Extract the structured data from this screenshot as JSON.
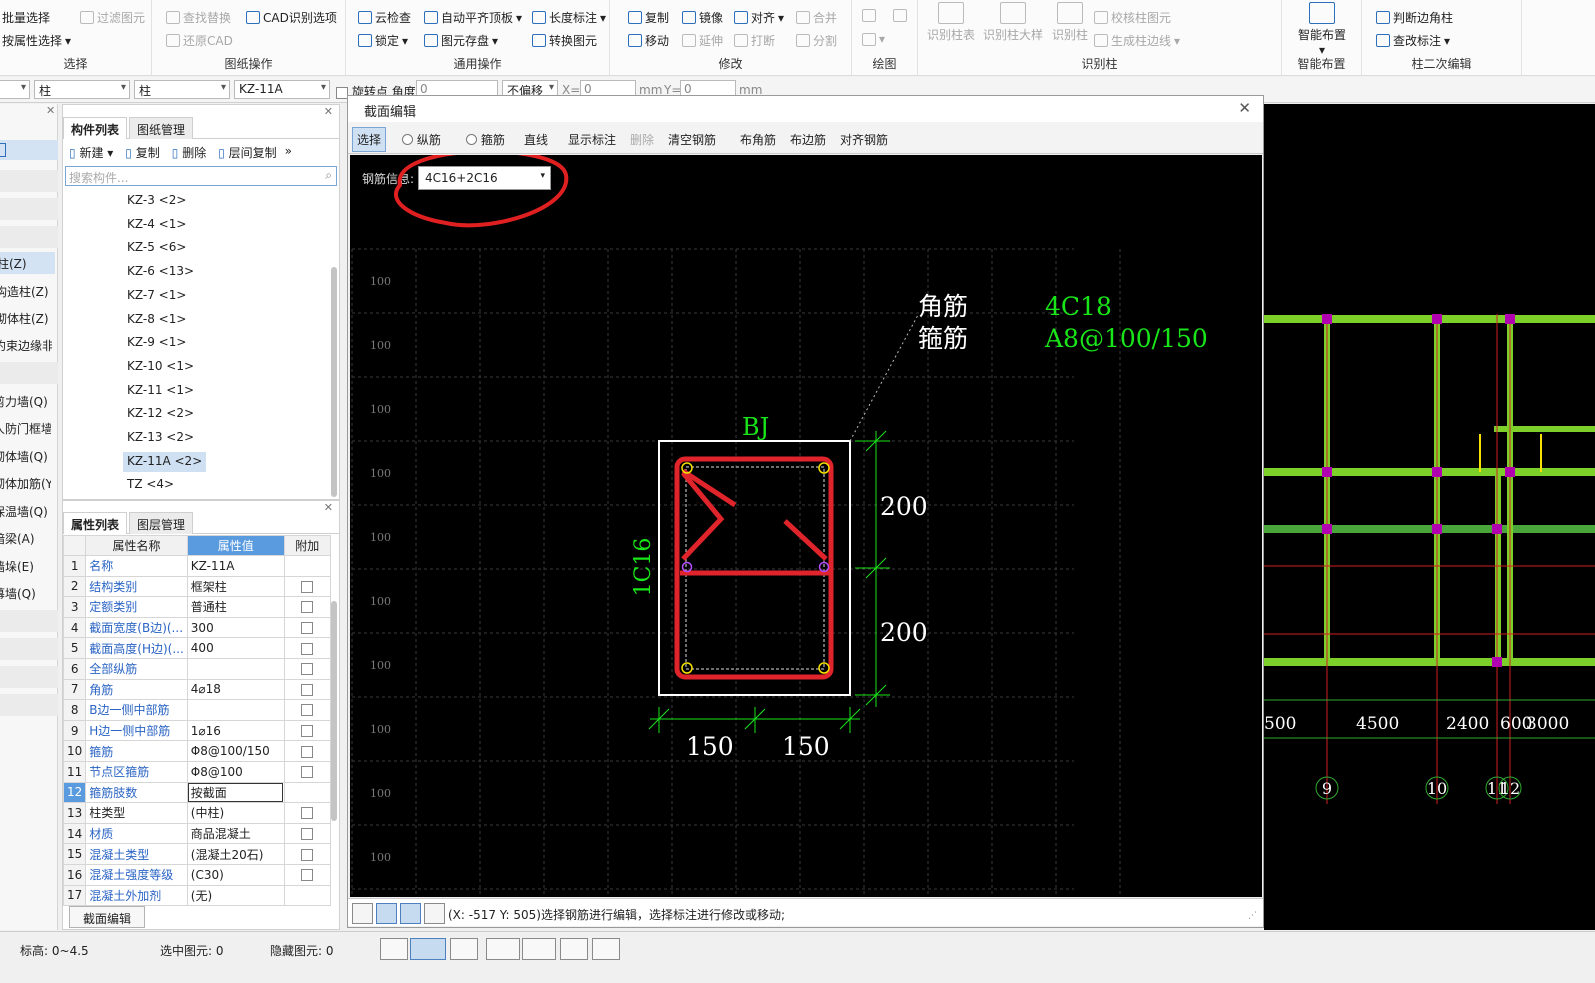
{
  "ribbon": {
    "select": {
      "label": "选择",
      "items": [
        "批量选择",
        "按属性选择"
      ],
      "disabled": [
        "过滤图元"
      ]
    },
    "drawing_ops": {
      "label": "图纸操作",
      "items": [
        "CAD识别选项"
      ],
      "disabled": [
        "查找替换",
        "还原CAD"
      ]
    },
    "common_ops": {
      "label": "通用操作",
      "items": [
        "云检查",
        "自动平齐顶板",
        "长度标注",
        "锁定",
        "图元存盘",
        "转换图元"
      ]
    },
    "modify": {
      "label": "修改",
      "items": [
        "复制",
        "镜像",
        "对齐",
        "移动",
        "延伸",
        "打断"
      ],
      "disabled": [
        "合并",
        "分割"
      ]
    },
    "draw": {
      "label": "绘图"
    },
    "recognize": {
      "label": "识别柱",
      "big": [
        "识别柱表",
        "识别柱大样",
        "识别柱"
      ],
      "small": [
        "校核柱图元",
        "生成柱边线"
      ]
    },
    "smart": {
      "label": "智能布置",
      "big": "智能布置"
    },
    "secondary": {
      "label": "柱二次编辑",
      "items": [
        "判断边角柱",
        "查改标注"
      ]
    }
  },
  "propbar": {
    "type1": "柱",
    "type2": "柱",
    "comp": "KZ-11A",
    "rotate": "旋转点",
    "angle_label": "角度",
    "angle": "0",
    "offset": "不偏移",
    "x_label": "X=",
    "x": "0",
    "unit1": "mm",
    "y_label": "Y=",
    "y": "0",
    "unit2": "mm"
  },
  "left_strip": [
    "柱(Z)",
    "构造柱(Z)",
    "砌体柱(Z)",
    "约束边缘非...",
    "剪力墙(Q)",
    "人防门框墙(...",
    "砌体墙(Q)",
    "砌体加筋(Y)",
    "保温墙(Q)",
    "暗梁(A)",
    "墙垛(E)",
    "幕墙(Q)"
  ],
  "comp_panel": {
    "tab1": "构件列表",
    "tab2": "图纸管理",
    "new": "新建",
    "copy": "复制",
    "delete": "删除",
    "floor_copy": "层间复制",
    "search_placeholder": "搜索构件...",
    "items": [
      "KZ-3 <2>",
      "KZ-4 <1>",
      "KZ-5 <6>",
      "KZ-6 <13>",
      "KZ-7 <1>",
      "KZ-8 <1>",
      "KZ-9 <1>",
      "KZ-10 <1>",
      "KZ-11 <1>",
      "KZ-12 <2>",
      "KZ-13 <2>",
      "KZ-11A <2>",
      "TZ <4>"
    ]
  },
  "prop_panel": {
    "tab1": "属性列表",
    "tab2": "图层管理",
    "col_name": "属性名称",
    "col_value": "属性值",
    "col_extra": "附加",
    "rows": [
      {
        "n": "1",
        "name": "名称",
        "value": "KZ-11A",
        "blue": true,
        "cb": false
      },
      {
        "n": "2",
        "name": "结构类别",
        "value": "框架柱",
        "blue": true,
        "cb": true
      },
      {
        "n": "3",
        "name": "定额类别",
        "value": "普通柱",
        "blue": true,
        "cb": true
      },
      {
        "n": "4",
        "name": "截面宽度(B边)(...",
        "value": "300",
        "blue": true,
        "cb": true
      },
      {
        "n": "5",
        "name": "截面高度(H边)(...",
        "value": "400",
        "blue": true,
        "cb": true
      },
      {
        "n": "6",
        "name": "全部纵筋",
        "value": "",
        "blue": true,
        "cb": true
      },
      {
        "n": "7",
        "name": "角筋",
        "value": "4⌀18",
        "blue": true,
        "cb": true
      },
      {
        "n": "8",
        "name": "B边一侧中部筋",
        "value": "",
        "blue": true,
        "cb": true
      },
      {
        "n": "9",
        "name": "H边一侧中部筋",
        "value": "1⌀16",
        "blue": true,
        "cb": true
      },
      {
        "n": "10",
        "name": "箍筋",
        "value": "Φ8@100/150",
        "blue": true,
        "cb": true
      },
      {
        "n": "11",
        "name": "节点区箍筋",
        "value": "Φ8@100",
        "blue": true,
        "cb": true
      },
      {
        "n": "12",
        "name": "箍筋肢数",
        "value": "按截面",
        "blue": true,
        "cb": false
      },
      {
        "n": "13",
        "name": "柱类型",
        "value": "(中柱)",
        "blue": false,
        "cb": true
      },
      {
        "n": "14",
        "name": "材质",
        "value": "商品混凝土",
        "blue": true,
        "cb": true
      },
      {
        "n": "15",
        "name": "混凝土类型",
        "value": "(混凝土20石)",
        "blue": true,
        "cb": true
      },
      {
        "n": "16",
        "name": "混凝土强度等级",
        "value": "(C30)",
        "blue": true,
        "cb": true
      },
      {
        "n": "17",
        "name": "混凝土外加剂",
        "value": "(无)",
        "blue": true,
        "cb": false
      }
    ],
    "section_edit_btn": "截面编辑"
  },
  "dialog": {
    "title": "截面编辑",
    "tools": {
      "select": "选择",
      "long_bar": "纵筋",
      "stirrup": "箍筋",
      "line": "直线",
      "show_dim": "显示标注",
      "delete": "删除",
      "clear": "清空钢筋",
      "corner": "布角筋",
      "edge": "布边筋",
      "align": "对齐钢筋"
    },
    "rebar_label": "钢筋信息:",
    "rebar_value": "4C16+2C16",
    "grid_label": "100",
    "bj": "BJ",
    "left_label": "1C16",
    "corner_label": "角筋",
    "stirrup_label": "箍筋",
    "corner_value": "4C18",
    "stirrup_value": "A8@100/150",
    "dim_h1": "200",
    "dim_h2": "200",
    "dim_w1": "150",
    "dim_w2": "150",
    "status": "(X: -517 Y: 505)选择钢筋进行编辑，选择标注进行修改或移动;"
  },
  "cad": {
    "dims": [
      "500",
      "4500",
      "2400",
      "600",
      "3000"
    ],
    "axes": [
      "9",
      "10",
      "11",
      "12"
    ]
  },
  "status": {
    "elev_label": "标高:",
    "elev": "0~4.5",
    "sel_label": "选中图元:",
    "sel": "0",
    "hid_label": "隐藏图元:",
    "hid": "0"
  },
  "colors": {
    "accent": "#2c6fbd",
    "rebar": "#e0242b",
    "dim": "#19e619",
    "highlight": "#e02020"
  }
}
